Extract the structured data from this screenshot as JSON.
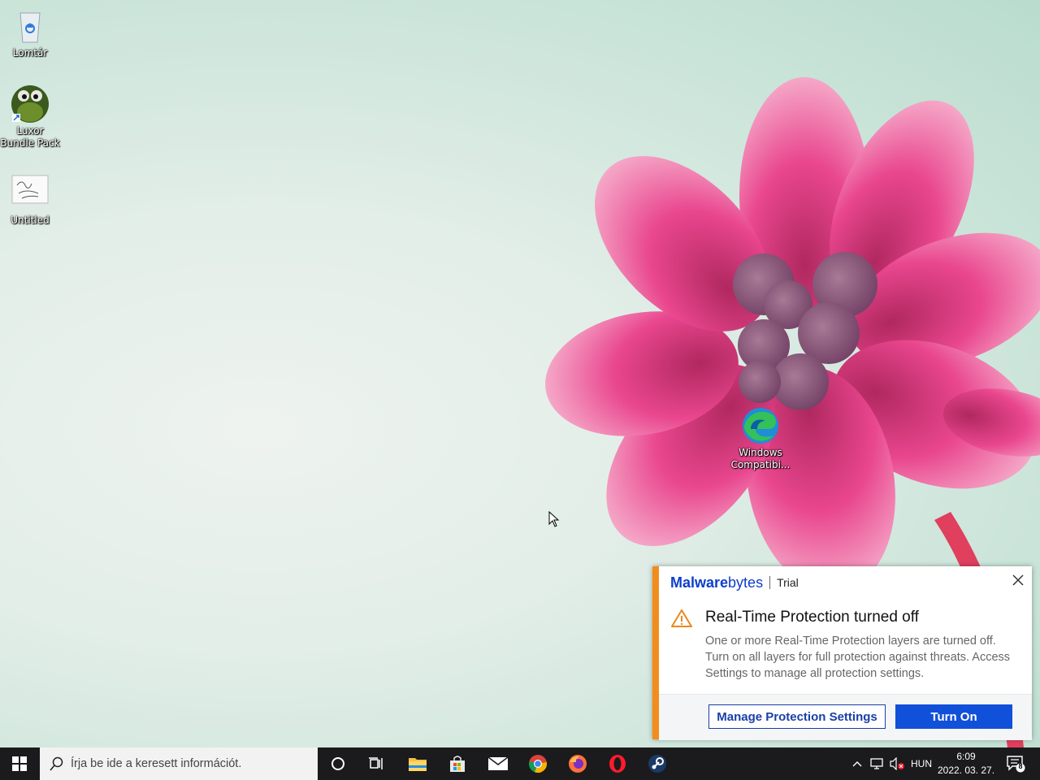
{
  "desktop": {
    "icons": [
      {
        "label": "Lomtár",
        "icon": "recycle-bin-icon"
      },
      {
        "label": "Luxor Bundle Pack",
        "icon": "luxor-game-icon"
      },
      {
        "label": "Untitled",
        "icon": "image-file-icon"
      },
      {
        "label": "Windows Compatibi...",
        "icon": "edge-icon"
      }
    ]
  },
  "popup": {
    "brand_bold": "Malware",
    "brand_light": "bytes",
    "plan": "Trial",
    "title": "Real-Time Protection turned off",
    "body": "One or more Real-Time Protection layers are turned off. Turn on all layers for full protection against threats. Access Settings to manage all protection settings.",
    "secondary_button": "Manage Protection Settings",
    "primary_button": "Turn On",
    "colors": {
      "accent": "#f28d1c",
      "primary": "#1150d9",
      "brand": "#0d3ecc"
    }
  },
  "taskbar": {
    "search_placeholder": "Írja be ide a keresett információt.",
    "apps": [
      "start-icon",
      "cortana-icon",
      "task-view-icon",
      "file-explorer-icon",
      "microsoft-store-icon",
      "mail-icon",
      "chrome-icon",
      "firefox-icon",
      "opera-icon",
      "steam-icon"
    ],
    "language": "HUN",
    "time": "6:09",
    "date": "2022. 03. 27.",
    "notification_count": "8"
  }
}
